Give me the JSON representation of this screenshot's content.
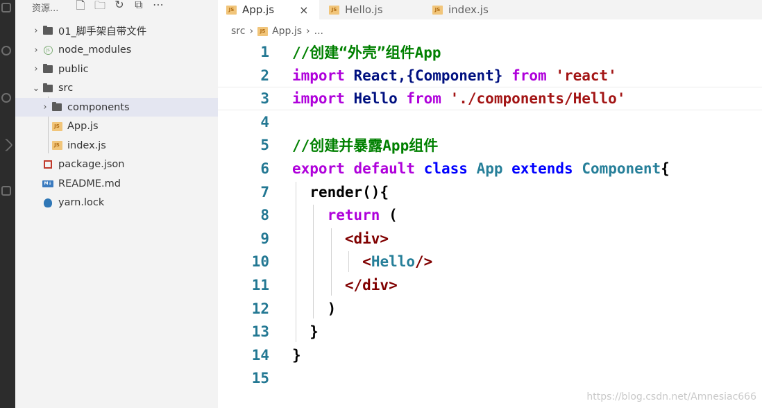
{
  "colors": {
    "comment": "#008000",
    "keyword": "#0000ff",
    "keyword_flow": "#af00db",
    "identifier": "#001080",
    "class_name": "#267f99",
    "string": "#a31515",
    "tag": "#800000",
    "plain": "#000000"
  },
  "sidebar": {
    "title": "资源...",
    "actions": [
      "new-file-icon",
      "new-folder-icon",
      "refresh-icon",
      "collapse-icon",
      "more-icon"
    ],
    "items": [
      {
        "label": "01_脚手架自带文件",
        "icon": "folder-icon",
        "chevron": "›"
      },
      {
        "label": "node_modules",
        "icon": "node-icon",
        "chevron": "›"
      },
      {
        "label": "public",
        "icon": "folder-icon",
        "chevron": "›"
      },
      {
        "label": "src",
        "icon": "folder-icon",
        "chevron": "⌄"
      },
      {
        "label": "components",
        "icon": "folder-icon",
        "chevron": "›"
      },
      {
        "label": "App.js",
        "icon": "js-icon"
      },
      {
        "label": "index.js",
        "icon": "js-icon"
      },
      {
        "label": "package.json",
        "icon": "json-icon"
      },
      {
        "label": "README.md",
        "icon": "markdown-icon"
      },
      {
        "label": "yarn.lock",
        "icon": "yarn-icon"
      }
    ]
  },
  "tabs": [
    {
      "label": "App.js",
      "close": "×"
    },
    {
      "label": "Hello.js"
    },
    {
      "label": "index.js"
    }
  ],
  "breadcrumb": {
    "folder": "src",
    "sep1": "›",
    "file": "App.js",
    "sep2": "›",
    "more": "..."
  },
  "editor": {
    "lines": [
      {
        "n": "1",
        "tokens": [
          [
            "//创建“外壳”组件App",
            "comment"
          ]
        ]
      },
      {
        "n": "2",
        "tokens": [
          [
            "import",
            "keyword_flow"
          ],
          [
            " React,{Component} ",
            "identifier"
          ],
          [
            "from",
            "keyword_flow"
          ],
          [
            " ",
            "plain"
          ],
          [
            "'react'",
            "string"
          ]
        ]
      },
      {
        "n": "3",
        "tokens": [
          [
            "import",
            "keyword_flow"
          ],
          [
            " Hello ",
            "identifier"
          ],
          [
            "from",
            "keyword_flow"
          ],
          [
            " ",
            "plain"
          ],
          [
            "'./components/Hello'",
            "string"
          ]
        ]
      },
      {
        "n": "4",
        "tokens": []
      },
      {
        "n": "5",
        "tokens": [
          [
            "//创建并暴露App组件",
            "comment"
          ]
        ]
      },
      {
        "n": "6",
        "tokens": [
          [
            "export",
            "keyword_flow"
          ],
          [
            " ",
            "plain"
          ],
          [
            "default",
            "keyword_flow"
          ],
          [
            " ",
            "plain"
          ],
          [
            "class",
            "keyword"
          ],
          [
            " ",
            "plain"
          ],
          [
            "App",
            "class_name"
          ],
          [
            " ",
            "plain"
          ],
          [
            "extends",
            "keyword"
          ],
          [
            " ",
            "plain"
          ],
          [
            "Component",
            "class_name"
          ],
          [
            "{",
            "plain"
          ]
        ]
      },
      {
        "n": "7",
        "tokens": [
          [
            "  ",
            "plain"
          ],
          [
            "render",
            "plain"
          ],
          [
            "(){",
            "plain"
          ]
        ]
      },
      {
        "n": "8",
        "tokens": [
          [
            "    ",
            "plain"
          ],
          [
            "return",
            "keyword_flow"
          ],
          [
            " (",
            "plain"
          ]
        ]
      },
      {
        "n": "9",
        "tokens": [
          [
            "      ",
            "plain"
          ],
          [
            "<div>",
            "tag"
          ]
        ]
      },
      {
        "n": "10",
        "tokens": [
          [
            "        ",
            "plain"
          ],
          [
            "<",
            "tag"
          ],
          [
            "Hello",
            "class_name"
          ],
          [
            "/>",
            "tag"
          ]
        ]
      },
      {
        "n": "11",
        "tokens": [
          [
            "      ",
            "plain"
          ],
          [
            "</div>",
            "tag"
          ]
        ]
      },
      {
        "n": "12",
        "tokens": [
          [
            "    ",
            "plain"
          ],
          [
            ")",
            "plain"
          ]
        ]
      },
      {
        "n": "13",
        "tokens": [
          [
            "  ",
            "plain"
          ],
          [
            "}",
            "plain"
          ]
        ]
      },
      {
        "n": "14",
        "tokens": [
          [
            "}",
            "plain"
          ]
        ]
      },
      {
        "n": "15",
        "tokens": []
      }
    ],
    "current_line": "3"
  },
  "watermark": "https://blog.csdn.net/Amnesiac666"
}
